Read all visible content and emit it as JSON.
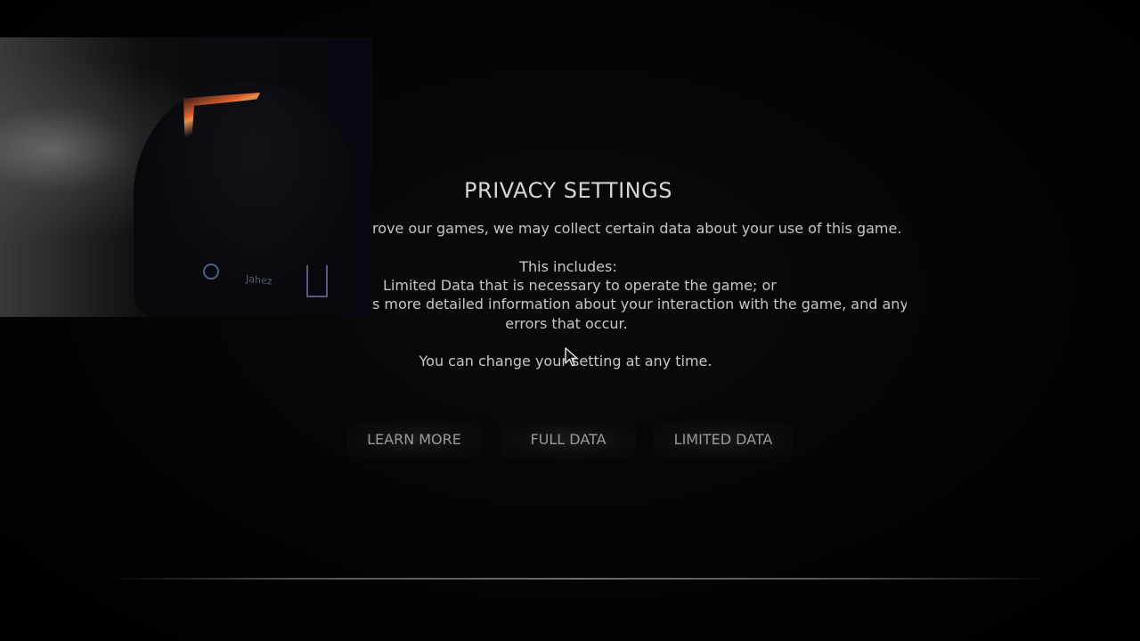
{
  "privacy": {
    "title": "PRIVACY SETTINGS",
    "line_collect": "rove our games, we may collect certain data about your use of this game.",
    "line_includes": "This includes:",
    "line_limited": "Limited Data that is necessary to operate the game; or",
    "line_full": "s more detailed information about your interaction with the game, and any",
    "line_errors": "errors that occur.",
    "line_change": "You can change your setting at any time."
  },
  "buttons": {
    "learn_more": "LEARN MORE",
    "full_data": "FULL DATA",
    "limited_data": "LIMITED DATA"
  },
  "webcam": {
    "jersey_text": "Jahez"
  },
  "colors": {
    "background": "#000000",
    "text": "#c6c6c6",
    "button_text": "#9a9a9a"
  }
}
